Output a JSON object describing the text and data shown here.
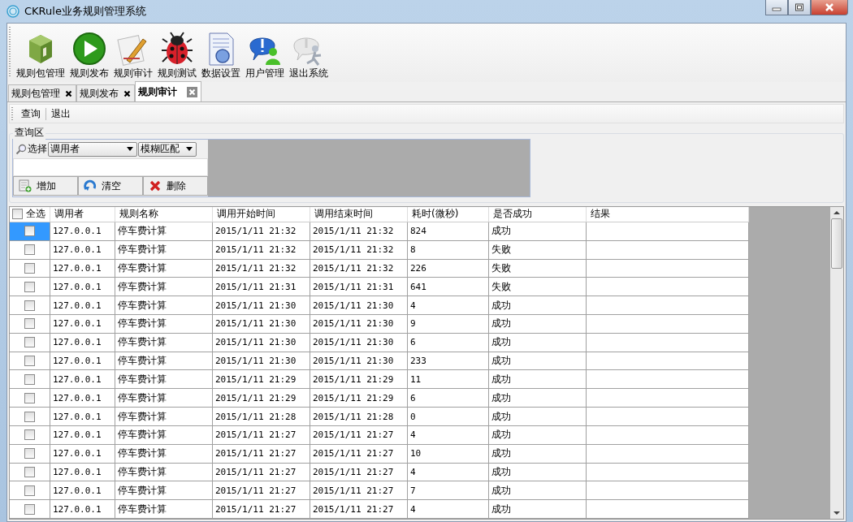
{
  "window": {
    "title": "CKRule业务规则管理系统"
  },
  "toolbar": [
    {
      "label": "规则包管理",
      "kind": "package"
    },
    {
      "label": "规则发布",
      "kind": "publish"
    },
    {
      "label": "规则审计",
      "kind": "audit"
    },
    {
      "label": "规则测试",
      "kind": "test"
    },
    {
      "label": "数据设置",
      "kind": "data"
    },
    {
      "label": "用户管理",
      "kind": "user"
    },
    {
      "label": "退出系统",
      "kind": "exit"
    }
  ],
  "tabs": [
    {
      "label": "规则包管理",
      "selected": false
    },
    {
      "label": "规则发布",
      "selected": false
    },
    {
      "label": "规则审计",
      "selected": true
    }
  ],
  "commands": [
    "查询",
    "退出"
  ],
  "query_area": {
    "title": "查询区",
    "select_label": "选择",
    "field_dropdown": "调用者",
    "match_dropdown": "模糊匹配",
    "buttons": [
      {
        "label": "增加",
        "kind": "add"
      },
      {
        "label": "清空",
        "kind": "clear"
      },
      {
        "label": "删除",
        "kind": "delete"
      }
    ]
  },
  "table": {
    "select_all": {
      "label": "全选",
      "checked": false
    },
    "columns": [
      "调用者",
      "规则名称",
      "调用开始时间",
      "调用结束时间",
      "耗时(微秒)",
      "是否成功",
      "结果"
    ],
    "rows": [
      {
        "selected": true,
        "checked": false,
        "cells": [
          "127.0.0.1",
          "停车费计算",
          "2015/1/11 21:32",
          "2015/1/11 21:32",
          "824",
          "成功",
          ""
        ]
      },
      {
        "selected": false,
        "checked": false,
        "cells": [
          "127.0.0.1",
          "停车费计算",
          "2015/1/11 21:32",
          "2015/1/11 21:32",
          "8",
          "失败",
          ""
        ]
      },
      {
        "selected": false,
        "checked": false,
        "cells": [
          "127.0.0.1",
          "停车费计算",
          "2015/1/11 21:32",
          "2015/1/11 21:32",
          "226",
          "失败",
          ""
        ]
      },
      {
        "selected": false,
        "checked": false,
        "cells": [
          "127.0.0.1",
          "停车费计算",
          "2015/1/11 21:31",
          "2015/1/11 21:31",
          "641",
          "失败",
          ""
        ]
      },
      {
        "selected": false,
        "checked": false,
        "cells": [
          "127.0.0.1",
          "停车费计算",
          "2015/1/11 21:30",
          "2015/1/11 21:30",
          "4",
          "成功",
          ""
        ]
      },
      {
        "selected": false,
        "checked": false,
        "cells": [
          "127.0.0.1",
          "停车费计算",
          "2015/1/11 21:30",
          "2015/1/11 21:30",
          "9",
          "成功",
          ""
        ]
      },
      {
        "selected": false,
        "checked": false,
        "cells": [
          "127.0.0.1",
          "停车费计算",
          "2015/1/11 21:30",
          "2015/1/11 21:30",
          "6",
          "成功",
          ""
        ]
      },
      {
        "selected": false,
        "checked": false,
        "cells": [
          "127.0.0.1",
          "停车费计算",
          "2015/1/11 21:30",
          "2015/1/11 21:30",
          "233",
          "成功",
          ""
        ]
      },
      {
        "selected": false,
        "checked": false,
        "cells": [
          "127.0.0.1",
          "停车费计算",
          "2015/1/11 21:29",
          "2015/1/11 21:29",
          "11",
          "成功",
          ""
        ]
      },
      {
        "selected": false,
        "checked": false,
        "cells": [
          "127.0.0.1",
          "停车费计算",
          "2015/1/11 21:29",
          "2015/1/11 21:29",
          "6",
          "成功",
          ""
        ]
      },
      {
        "selected": false,
        "checked": false,
        "cells": [
          "127.0.0.1",
          "停车费计算",
          "2015/1/11 21:28",
          "2015/1/11 21:28",
          "0",
          "成功",
          ""
        ]
      },
      {
        "selected": false,
        "checked": false,
        "cells": [
          "127.0.0.1",
          "停车费计算",
          "2015/1/11 21:27",
          "2015/1/11 21:27",
          "4",
          "成功",
          ""
        ]
      },
      {
        "selected": false,
        "checked": false,
        "cells": [
          "127.0.0.1",
          "停车费计算",
          "2015/1/11 21:27",
          "2015/1/11 21:27",
          "10",
          "成功",
          ""
        ]
      },
      {
        "selected": false,
        "checked": false,
        "cells": [
          "127.0.0.1",
          "停车费计算",
          "2015/1/11 21:27",
          "2015/1/11 21:27",
          "4",
          "成功",
          ""
        ]
      },
      {
        "selected": false,
        "checked": false,
        "cells": [
          "127.0.0.1",
          "停车费计算",
          "2015/1/11 21:27",
          "2015/1/11 21:27",
          "7",
          "成功",
          ""
        ]
      },
      {
        "selected": false,
        "checked": false,
        "cells": [
          "127.0.0.1",
          "停车费计算",
          "2015/1/11 21:27",
          "2015/1/11 21:27",
          "4",
          "成功",
          ""
        ]
      }
    ]
  }
}
